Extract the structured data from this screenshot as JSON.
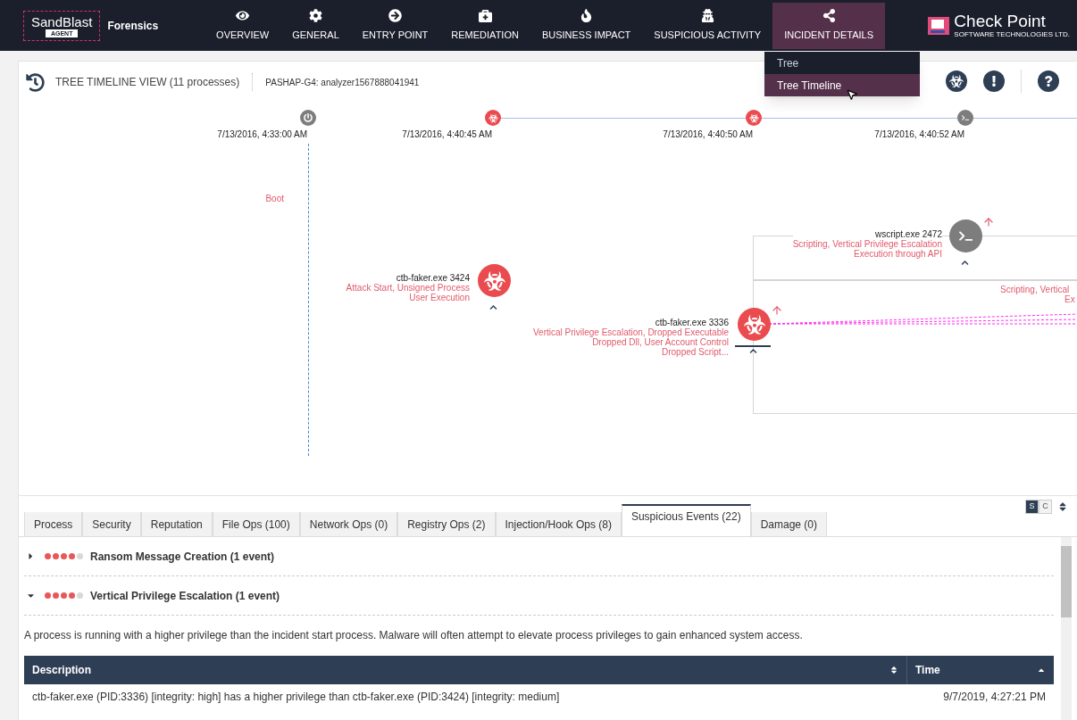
{
  "brand": {
    "name": "SandBlast",
    "badge": "AGENT",
    "product": "Forensics"
  },
  "nav": [
    {
      "label": "OVERVIEW",
      "selected": false
    },
    {
      "label": "GENERAL",
      "selected": false
    },
    {
      "label": "ENTRY POINT",
      "selected": false
    },
    {
      "label": "REMEDIATION",
      "selected": false
    },
    {
      "label": "BUSINESS IMPACT",
      "selected": false
    },
    {
      "label": "SUSPICIOUS ACTIVITY",
      "selected": false
    },
    {
      "label": "INCIDENT DETAILS",
      "selected": true
    }
  ],
  "vendor": {
    "name": "Check Point",
    "tagline": "SOFTWARE TECHNOLOGIES LTD."
  },
  "view_menu": [
    {
      "label": "Tree",
      "selected": false
    },
    {
      "label": "Tree Timeline",
      "selected": true
    }
  ],
  "view": {
    "title": "TREE TIMELINE VIEW (11 processes)",
    "host": "PASHAP-G4: analyzer1567888041941"
  },
  "timeline": [
    {
      "time": "7/13/2016, 4:33:00 AM",
      "kind": "boot"
    },
    {
      "time": "7/13/2016, 4:40:45 AM",
      "kind": "malware"
    },
    {
      "time": "7/13/2016, 4:40:50 AM",
      "kind": "malware"
    },
    {
      "time": "7/13/2016, 4:40:52 AM",
      "kind": "script"
    }
  ],
  "boot_label": "Boot",
  "nodes": [
    {
      "name": "ctb-faker.exe 3424",
      "tags": [
        "Attack Start, Unsigned Process",
        "User Execution"
      ],
      "kind": "malware",
      "elevated": false
    },
    {
      "name": "ctb-faker.exe 3336",
      "tags": [
        "Vertical Privilege Escalation, Dropped Executable",
        "Dropped Dll, User Account Control",
        "Dropped Script..."
      ],
      "kind": "malware",
      "elevated": true
    },
    {
      "name": "wscript.exe 2472",
      "tags": [
        "Scripting, Vertical Privilege Escalation",
        "Execution through API"
      ],
      "kind": "script",
      "elevated": true
    }
  ],
  "offscreen_tags": [
    "Scripting, Vertical",
    "Ex"
  ],
  "detail_tabs": [
    {
      "label": "Process",
      "selected": false
    },
    {
      "label": "Security",
      "selected": false
    },
    {
      "label": "Reputation",
      "selected": false
    },
    {
      "label": "File Ops (100)",
      "selected": false
    },
    {
      "label": "Network Ops (0)",
      "selected": false
    },
    {
      "label": "Registry Ops (2)",
      "selected": false
    },
    {
      "label": "Injection/Hook Ops (8)",
      "selected": false
    },
    {
      "label": "Suspicious Events (22)",
      "selected": true
    },
    {
      "label": "Damage (0)",
      "selected": false
    }
  ],
  "mode_toggle": [
    {
      "label": "S",
      "selected": true
    },
    {
      "label": "C",
      "selected": false
    }
  ],
  "events": [
    {
      "title": "Ransom Message Creation (1 event)",
      "expanded": false,
      "stars": 4
    },
    {
      "title": "Vertical Privilege Escalation (1 event)",
      "expanded": true,
      "stars": 4,
      "description": "A process is running with a higher privilege than the incident start process. Malware will often attempt to elevate process privileges to gain enhanced system access.",
      "table": {
        "columns": [
          "Description",
          "Time"
        ],
        "rows": [
          [
            "ctb-faker.exe (PID:3336) [integrity: high] has a higher privilege than ctb-faker.exe (PID:3424) [integrity: medium]",
            "9/7/2019, 4:27:21 PM"
          ]
        ]
      }
    }
  ]
}
